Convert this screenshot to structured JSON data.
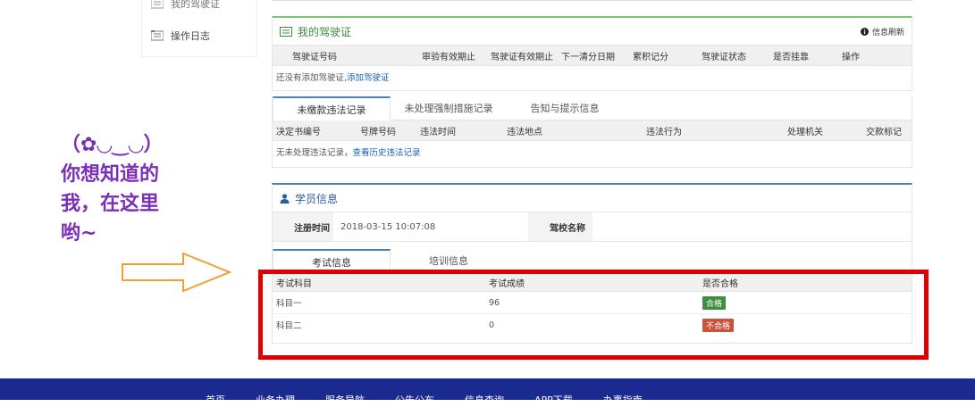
{
  "sidebar": {
    "items": [
      {
        "label": "我的驾驶证"
      },
      {
        "label": "操作日志"
      }
    ]
  },
  "license_panel": {
    "title": "我的驾驶证",
    "refresh_label": "信息刷新",
    "columns": [
      "驾驶证号码",
      "审验有效期止",
      "驾驶证有效期止",
      "下一清分日期",
      "累积记分",
      "驾驶证状态",
      "是否挂靠",
      "操作"
    ],
    "empty_text": "还没有添加驾驶证,",
    "add_link": "添加驾驶证"
  },
  "violation_panel": {
    "tabs": [
      "未缴款违法记录",
      "未处理强制措施记录",
      "告知与提示信息"
    ],
    "columns": [
      "决定书编号",
      "号牌号码",
      "违法时间",
      "违法地点",
      "违法行为",
      "处理机关",
      "交款标记"
    ],
    "empty_text": "无未处理违法记录，",
    "history_link": "查看历史违法记录"
  },
  "student_panel": {
    "title": "学员信息",
    "reg_time_label": "注册时间",
    "reg_time_value": "2018-03-15 10:07:08",
    "school_label": "驾校名称",
    "school_value": "",
    "tabs": [
      "考试信息",
      "培训信息"
    ],
    "columns": [
      "考试科目",
      "考试成绩",
      "是否合格"
    ],
    "rows": [
      {
        "subject": "科目一",
        "score": "96",
        "result": "合格",
        "status": "pass"
      },
      {
        "subject": "科目二",
        "score": "0",
        "result": "不合格",
        "status": "fail"
      }
    ]
  },
  "annotation": {
    "line1": "（✿◡‿◡）",
    "line2": "你想知道的",
    "line3": "我，在这里",
    "line4": "哟~"
  },
  "footer": {
    "nav": [
      "首页",
      "业务办理",
      "服务导航",
      "公告公布",
      "信息查询",
      "APP下载",
      "办事指南"
    ]
  },
  "colors": {
    "annotation": "#7b2fb8",
    "highlight_box": "#e10000",
    "footer_bg": "#1b2a8f",
    "pass_badge": "#3f8d3f",
    "fail_badge": "#c9533b"
  }
}
